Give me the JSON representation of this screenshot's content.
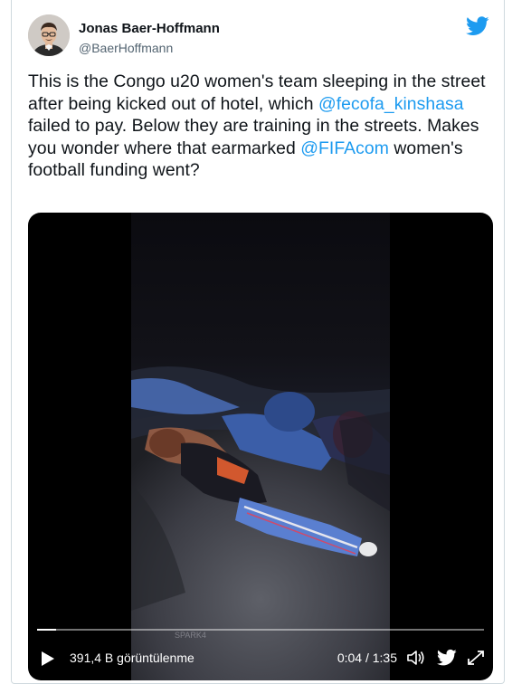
{
  "author": {
    "name": "Jonas Baer-Hoffmann",
    "handle": "@BaerHoffmann",
    "avatar_icon": "avatar-photo"
  },
  "brand": {
    "icon": "twitter-bird-icon",
    "color": "#1d9bf0"
  },
  "tweet": {
    "segments": [
      {
        "type": "text",
        "value": "This is the Congo u20 women's team sleeping in the street after being kicked out of hotel, which "
      },
      {
        "type": "link",
        "value": "@fecofa_kinshasa"
      },
      {
        "type": "text",
        "value": " failed to pay. Below they are training in the streets. Makes you wonder where that earmarked "
      },
      {
        "type": "link",
        "value": "@FIFAcom"
      },
      {
        "type": "text",
        "value": " women's football funding went?"
      }
    ]
  },
  "video": {
    "views": "391,4 B görüntülenme",
    "time": "0:04 / 1:35",
    "progress": 0.042,
    "watermark": "SPARK4",
    "controls": {
      "play": "play-icon",
      "volume": "volume-icon",
      "twitter": "twitter-bird-icon",
      "fullscreen": "fullscreen-icon"
    }
  }
}
